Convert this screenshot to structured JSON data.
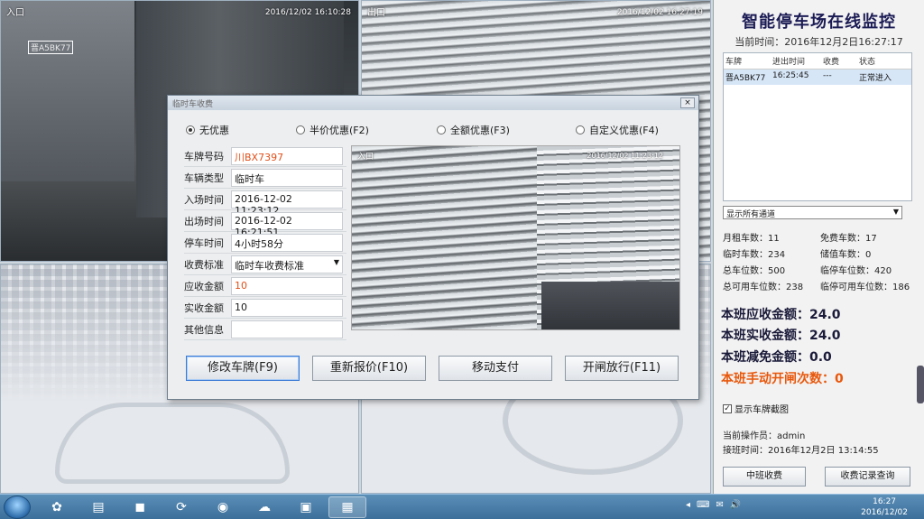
{
  "cameras": {
    "cam1": {
      "label": "入口",
      "timestamp": "2016/12/02 16:10:28",
      "plate_tag": "晋A5BK77"
    },
    "cam2": {
      "label": "出口",
      "timestamp": "2016/12/02 16:27:19"
    }
  },
  "monitor": {
    "title": "智能停车场在线监控",
    "current_time": "当前时间：2016年12月2日16:27:17",
    "table": {
      "headers": [
        "车牌",
        "进出时间",
        "收费",
        "状态"
      ],
      "rows": [
        [
          "晋A5BK77",
          "16:25:45",
          "---",
          "正常进入"
        ]
      ]
    },
    "channel_select": "显示所有通道",
    "stats": [
      [
        "月租车数：11",
        "免费车数：17"
      ],
      [
        "临时车数：234",
        "储值车数：0"
      ],
      [
        "总车位数：500",
        "临停车位数：420"
      ],
      [
        "总可用车位数：238",
        "临停可用车位数：186"
      ]
    ],
    "totals": {
      "receivable": "本班应收金额：24.0",
      "received": "本班实收金额：24.0",
      "discount": "本班减免金额：0.0",
      "manual_open": "本班手动开闸次数：0"
    },
    "show_snapshot_label": "显示车牌截图",
    "operator": "当前操作员：admin",
    "shift_time": "接班时间：2016年12月2日 13:14:55",
    "btn_shift": "中班收费",
    "btn_records": "收费记录查询"
  },
  "dialog": {
    "title": "临时车收费",
    "close": "×",
    "radios": [
      "无优惠",
      "半价优惠(F2)",
      "全额优惠(F3)",
      "自定义优惠(F4)"
    ],
    "fields": [
      {
        "label": "车牌号码",
        "value": "川BX7397"
      },
      {
        "label": "车辆类型",
        "value": "临时车"
      },
      {
        "label": "入场时间",
        "value": "2016-12-02 11:23:12"
      },
      {
        "label": "出场时间",
        "value": "2016-12-02 16:21:51"
      },
      {
        "label": "停车时间",
        "value": "4小时58分"
      },
      {
        "label": "收费标准",
        "value": "临时车收费标准"
      },
      {
        "label": "应收金额",
        "value": "10"
      },
      {
        "label": "实收金额",
        "value": "10"
      },
      {
        "label": "其他信息",
        "value": ""
      }
    ],
    "snapshot": {
      "label": "入口",
      "timestamp": "2016/12/02 11:23:12"
    },
    "buttons": [
      "修改车牌(F9)",
      "重新报价(F10)",
      "移动支付",
      "开闸放行(F11)"
    ]
  },
  "taskbar": {
    "clock_time": "16:27",
    "clock_date": "2016/12/02",
    "tray": [
      "◂",
      "⌨",
      "✉",
      "🔊"
    ]
  }
}
